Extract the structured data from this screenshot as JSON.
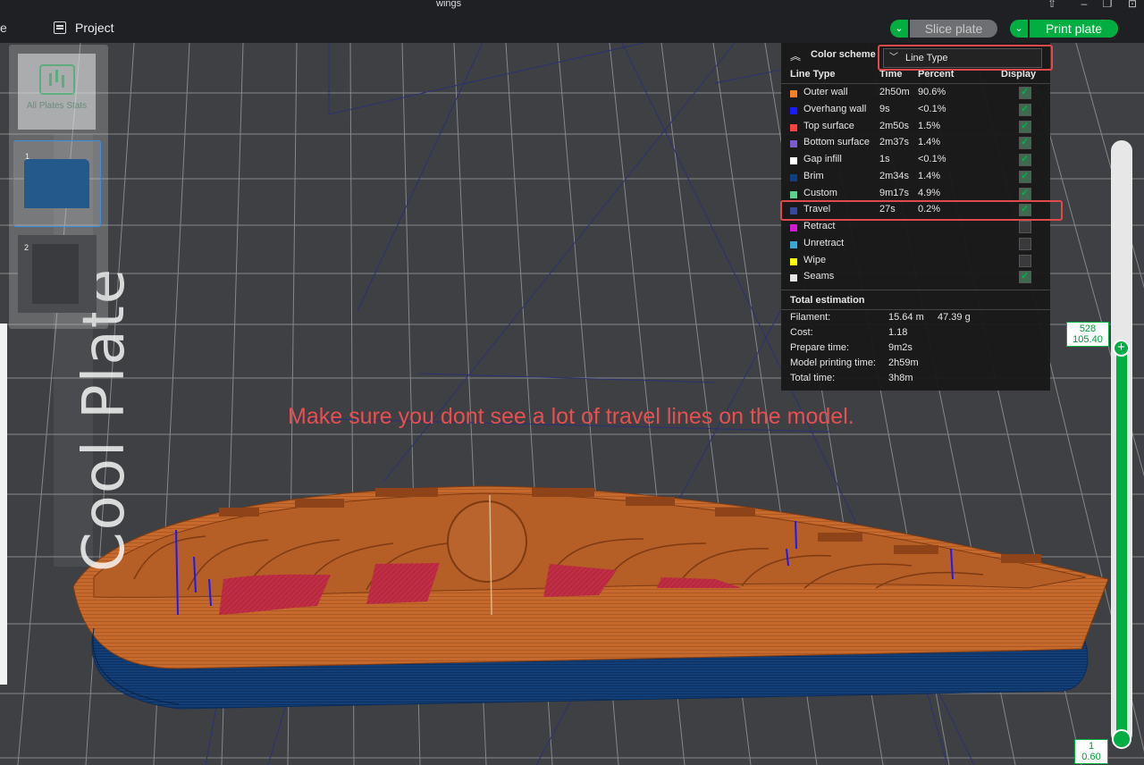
{
  "window": {
    "title": "wings"
  },
  "toolbar": {
    "left_glyph": "e",
    "project_label": "Project",
    "slice_label": "Slice plate",
    "print_label": "Print plate"
  },
  "plates": {
    "stats_label": "All Plates Stats",
    "thumb1_num": "1",
    "thumb2_num": "2",
    "plate_label": "Cool Plate"
  },
  "legend": {
    "scheme_label": "Color scheme",
    "scheme_value": "Line Type",
    "columns": {
      "type": "Line Type",
      "time": "Time",
      "percent": "Percent",
      "display": "Display"
    },
    "rows": [
      {
        "name": "Outer wall",
        "time": "2h50m",
        "percent": "90.6%",
        "color": "#ff7f27",
        "display": true
      },
      {
        "name": "Overhang wall",
        "time": "9s",
        "percent": "<0.1%",
        "color": "#1a19ff",
        "display": true
      },
      {
        "name": "Top surface",
        "time": "2m50s",
        "percent": "1.5%",
        "color": "#ff4040",
        "display": true
      },
      {
        "name": "Bottom surface",
        "time": "2m37s",
        "percent": "1.4%",
        "color": "#7a5ccf",
        "display": true
      },
      {
        "name": "Gap infill",
        "time": "1s",
        "percent": "<0.1%",
        "color": "#ffffff",
        "display": true
      },
      {
        "name": "Brim",
        "time": "2m34s",
        "percent": "1.4%",
        "color": "#0f3f80",
        "display": true
      },
      {
        "name": "Custom",
        "time": "9m17s",
        "percent": "4.9%",
        "color": "#5dd28c",
        "display": true
      },
      {
        "name": "Travel",
        "time": "27s",
        "percent": "0.2%",
        "color": "#38489a",
        "display": true
      },
      {
        "name": "Retract",
        "time": "",
        "percent": "",
        "color": "#d41ad8",
        "display": false
      },
      {
        "name": "Unretract",
        "time": "",
        "percent": "",
        "color": "#3aa6d6",
        "display": false
      },
      {
        "name": "Wipe",
        "time": "",
        "percent": "",
        "color": "#ffff00",
        "display": false
      },
      {
        "name": "Seams",
        "time": "",
        "percent": "",
        "color": "#e6e6e6",
        "display": true
      }
    ],
    "total_title": "Total estimation",
    "totals": [
      {
        "key": "Filament:",
        "value": "15.64 m",
        "value2": "47.39 g"
      },
      {
        "key": "Cost:",
        "value": "1.18",
        "value2": ""
      },
      {
        "key": "Prepare time:",
        "value": "9m2s",
        "value2": ""
      },
      {
        "key": "Model printing time:",
        "value": "2h59m",
        "value2": ""
      },
      {
        "key": "Total time:",
        "value": "3h8m",
        "value2": ""
      }
    ]
  },
  "annotation": {
    "note": "Make sure you dont see a lot of travel lines on the model."
  },
  "layer_slider": {
    "top_layer": "528",
    "top_height": "105.40",
    "bottom_layer": "1",
    "bottom_height": "0.60"
  },
  "colors": {
    "accent": "#00ae42",
    "highlight": "#e14a4a",
    "model": "#c76a2e",
    "brim": "#0f3f80",
    "top_surface": "#c0324a"
  }
}
